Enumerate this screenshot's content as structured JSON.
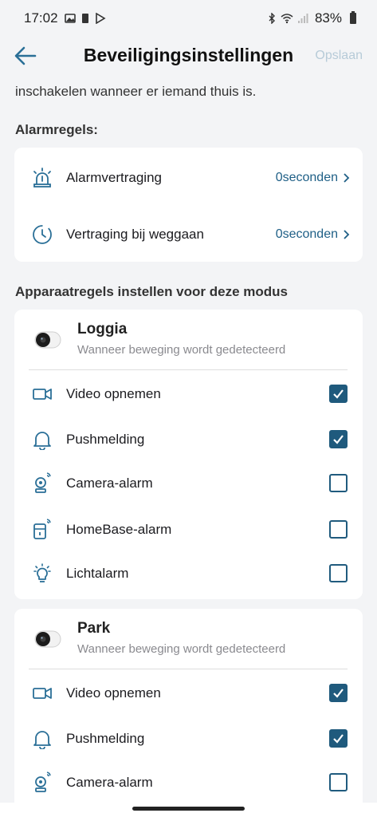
{
  "status_bar": {
    "time": "17:02",
    "battery": "83%"
  },
  "header": {
    "title": "Beveiligingsinstellingen",
    "save_label": "Opslaan"
  },
  "intro_text": "inschakelen wanneer er iemand thuis is.",
  "alarm_rules": {
    "section_title": "Alarmregels:",
    "items": [
      {
        "label": "Alarmvertraging",
        "value": "0seconden",
        "icon": "siren-icon"
      },
      {
        "label": "Vertraging bij weggaan",
        "value": "0seconden",
        "icon": "timer-icon"
      }
    ]
  },
  "device_rules": {
    "section_title": "Apparaatregels instellen voor deze modus",
    "devices": [
      {
        "name": "Loggia",
        "subtitle": "Wanneer beweging wordt gedetecteerd",
        "options": [
          {
            "label": "Video opnemen",
            "checked": true,
            "icon": "video-camera-icon"
          },
          {
            "label": "Pushmelding",
            "checked": true,
            "icon": "bell-icon"
          },
          {
            "label": "Camera-alarm",
            "checked": false,
            "icon": "camera-alarm-icon"
          },
          {
            "label": "HomeBase-alarm",
            "checked": false,
            "icon": "homebase-alarm-icon"
          },
          {
            "label": "Lichtalarm",
            "checked": false,
            "icon": "light-bulb-icon"
          }
        ]
      },
      {
        "name": "Park",
        "subtitle": "Wanneer beweging wordt gedetecteerd",
        "options": [
          {
            "label": "Video opnemen",
            "checked": true,
            "icon": "video-camera-icon"
          },
          {
            "label": "Pushmelding",
            "checked": true,
            "icon": "bell-icon"
          },
          {
            "label": "Camera-alarm",
            "checked": false,
            "icon": "camera-alarm-icon"
          }
        ]
      }
    ]
  },
  "colors": {
    "accent": "#1f5a7d",
    "icon": "#2a6f97",
    "save_disabled": "#b7cbd8",
    "background": "#f3f4f6"
  }
}
